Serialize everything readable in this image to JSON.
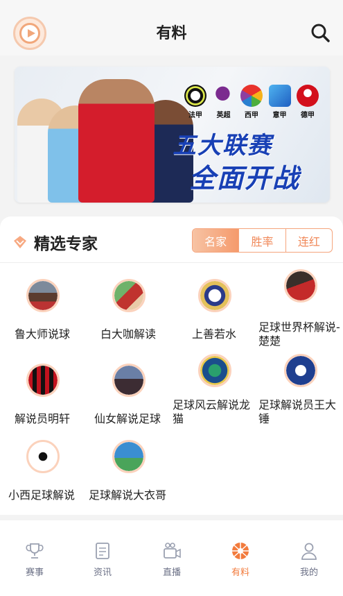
{
  "header": {
    "title": "有料"
  },
  "banner": {
    "leagues": [
      "法甲",
      "英超",
      "西甲",
      "意甲",
      "德甲"
    ],
    "slogan_line1": "五大联赛",
    "slogan_line2": "全面开战"
  },
  "section": {
    "title": "精选专家",
    "tabs": [
      "名家",
      "胜率",
      "连红"
    ],
    "active_tab": "名家"
  },
  "experts": [
    {
      "name": "鲁大师说球"
    },
    {
      "name": "白大咖解读"
    },
    {
      "name": "上善若水"
    },
    {
      "name": "足球世界杯解说-楚楚"
    },
    {
      "name": "解说员明轩"
    },
    {
      "name": "仙女解说足球"
    },
    {
      "name": "足球风云解说龙猫"
    },
    {
      "name": "足球解说员王大锤"
    },
    {
      "name": "小西足球解说"
    },
    {
      "name": "足球解说大衣哥"
    }
  ],
  "tabbar": {
    "items": [
      "赛事",
      "资讯",
      "直播",
      "有料",
      "我的"
    ],
    "active": "有料"
  },
  "colors": {
    "accent": "#f27b3d",
    "tab_inactive": "#6b7086",
    "slogan": "#1840b5"
  }
}
